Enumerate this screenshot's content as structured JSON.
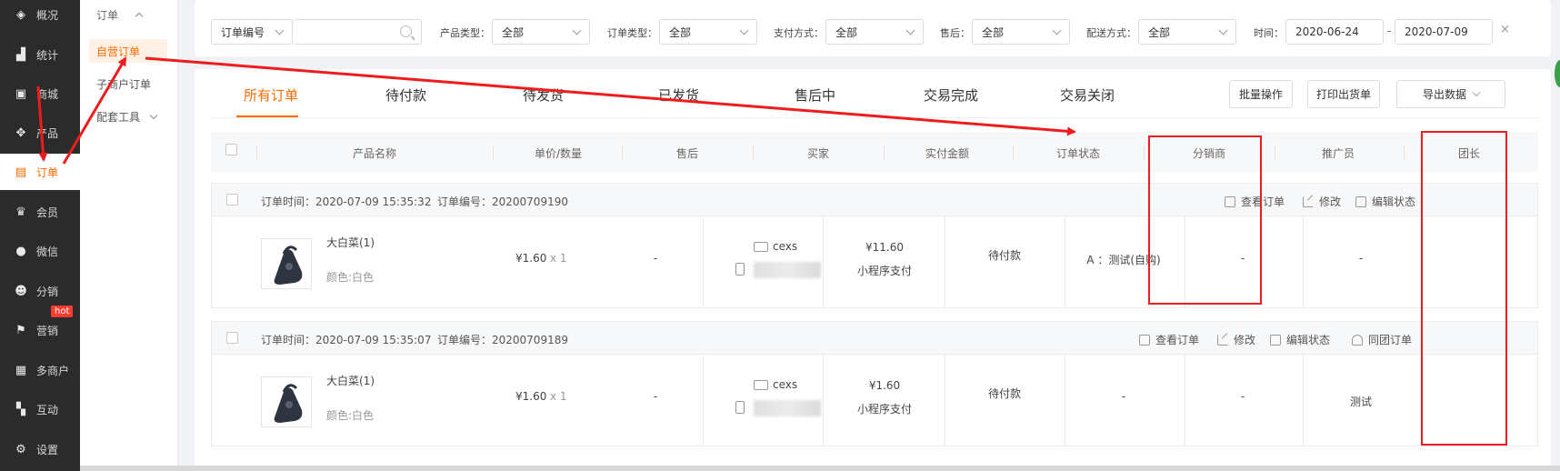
{
  "sidebar": {
    "items": [
      {
        "label": "概况",
        "icon": "layers-icon",
        "active": false
      },
      {
        "label": "统计",
        "icon": "chart-icon",
        "active": false
      },
      {
        "label": "商城",
        "icon": "store-icon",
        "active": false
      },
      {
        "label": "产品",
        "icon": "grid-icon",
        "active": false
      },
      {
        "label": "订单",
        "icon": "order-icon",
        "active": true
      },
      {
        "label": "会员",
        "icon": "crown-icon",
        "active": false
      },
      {
        "label": "微信",
        "icon": "wechat-icon",
        "active": false
      },
      {
        "label": "分销",
        "icon": "users-icon",
        "active": false
      },
      {
        "label": "营销",
        "icon": "flag-icon",
        "active": false,
        "badge": "hot"
      },
      {
        "label": "多商户",
        "icon": "merchant-icon",
        "active": false
      },
      {
        "label": "互动",
        "icon": "interact-icon",
        "active": false
      },
      {
        "label": "设置",
        "icon": "gear-icon",
        "active": false
      }
    ]
  },
  "submenu": {
    "group": "订单",
    "items": [
      {
        "label": "自营订单",
        "active": true
      },
      {
        "label": "子商户订单",
        "active": false
      },
      {
        "label": "配套工具",
        "active": false
      }
    ]
  },
  "filters": {
    "order_field": "订单编号",
    "search_value": "",
    "product_type_label": "产品类型：",
    "product_type_value": "全部",
    "order_type_label": "订单类型：",
    "order_type_value": "全部",
    "pay_label": "支付方式：",
    "pay_value": "全部",
    "after_sale_label": "售后：",
    "after_sale_value": "全部",
    "delivery_label": "配送方式：",
    "delivery_value": "全部",
    "time_label": "时间：",
    "date_start": "2020-06-24",
    "date_sep": "-",
    "date_end": "2020-07-09",
    "clear": "×"
  },
  "tabs": [
    "所有订单",
    "待付款",
    "待发货",
    "已发货",
    "售后中",
    "交易完成",
    "交易关闭"
  ],
  "actions": {
    "batch": "批量操作",
    "print": "打印出货单",
    "export": "导出数据"
  },
  "table": {
    "headers": [
      "产品名称",
      "单价/数量",
      "售后",
      "买家",
      "实付金额",
      "订单状态",
      "分销商",
      "推广员",
      "团长"
    ]
  },
  "orders": [
    {
      "time_label": "订单时间：2020-07-09 15:35:32",
      "no_label": "订单编号：20200709190",
      "ops": [
        "查看订单",
        "修改",
        "编辑状态"
      ],
      "product_name": "大白菜(1)",
      "spec": "颜色:白色",
      "price": "¥1.60",
      "qty": "x 1",
      "after_sale": "-",
      "buyer": "cexs",
      "paid": "¥11.60",
      "pay_method": "小程序支付",
      "status": "待付款",
      "distributor": "A ：测试(自购)",
      "promoter": "-",
      "leader": "-"
    },
    {
      "time_label": "订单时间：2020-07-09 15:35:07",
      "no_label": "订单编号：20200709189",
      "ops": [
        "查看订单",
        "修改",
        "编辑状态",
        "同团订单"
      ],
      "product_name": "大白菜(1)",
      "spec": "颜色:白色",
      "price": "¥1.60",
      "qty": "x 1",
      "after_sale": "-",
      "buyer": "cexs",
      "paid": "¥1.60",
      "pay_method": "小程序支付",
      "status": "待付款",
      "distributor": "-",
      "promoter": "-",
      "leader": "测试"
    }
  ],
  "colors": {
    "accent": "#ff6a00",
    "sidebar_bg": "#2b2b2b",
    "annotation_red": "#ee1c1c"
  }
}
